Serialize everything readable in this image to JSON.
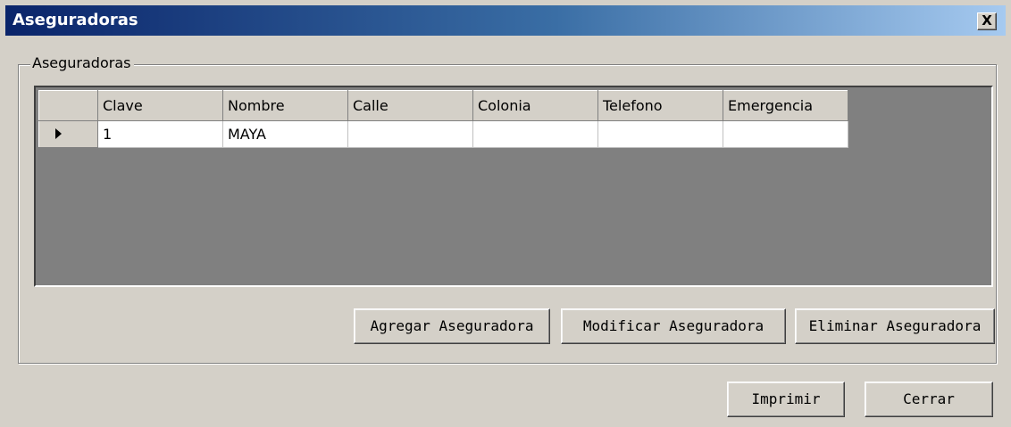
{
  "window": {
    "title": "Aseguradoras",
    "close_label": "X"
  },
  "group": {
    "legend": "Aseguradoras"
  },
  "grid": {
    "columns": [
      "Clave",
      "Nombre",
      "Calle",
      "Colonia",
      "Telefono",
      "Emergencia"
    ],
    "rows": [
      {
        "current": true,
        "cells": [
          "1",
          "MAYA",
          "",
          "",
          "",
          ""
        ]
      }
    ]
  },
  "actions": {
    "add_label": "Agregar Aseguradora",
    "modify_label": "Modificar Aseguradora",
    "delete_label": "Eliminar Aseguradora"
  },
  "footer": {
    "print_label": "Imprimir",
    "close_label": "Cerrar"
  }
}
